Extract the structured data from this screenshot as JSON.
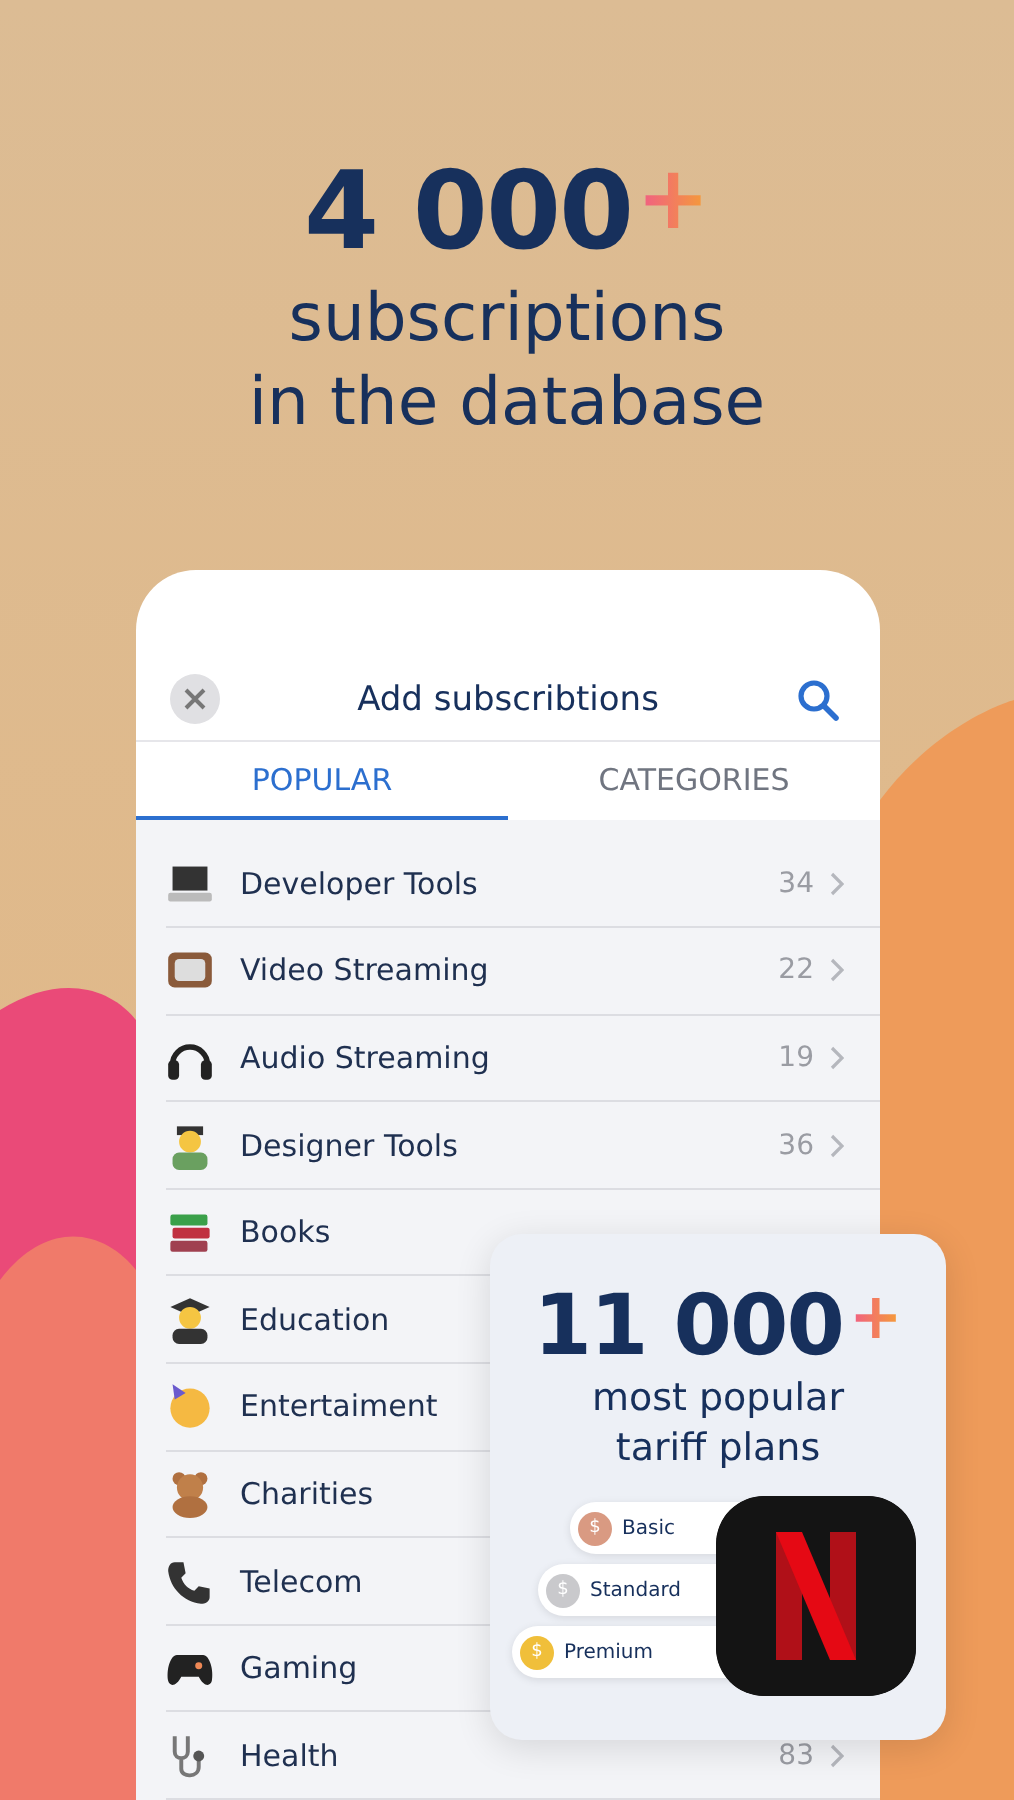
{
  "headline": {
    "number": "4 000",
    "plus": "+",
    "lines": [
      "subscriptions",
      "in the database"
    ]
  },
  "panel": {
    "title": "Add subscribtions",
    "tabs": [
      {
        "label": "POPULAR",
        "selected": true
      },
      {
        "label": "CATEGORIES",
        "selected": false
      }
    ],
    "rows": [
      {
        "label": "Developer Tools",
        "count": "34"
      },
      {
        "label": "Video Streaming",
        "count": "22"
      },
      {
        "label": "Audio Streaming",
        "count": "19"
      },
      {
        "label": "Designer Tools",
        "count": "36"
      },
      {
        "label": "Books"
      },
      {
        "label": "Education"
      },
      {
        "label": "Entertaiment"
      },
      {
        "label": "Charities"
      },
      {
        "label": "Telecom"
      },
      {
        "label": "Gaming"
      },
      {
        "label": "Health",
        "count": "83"
      }
    ]
  },
  "plans_card": {
    "number": "11 000",
    "plus": "+",
    "lines": [
      "most popular",
      "tariff plans"
    ],
    "plans": [
      {
        "coin": "$",
        "label": "Basic",
        "color": "#d99a82"
      },
      {
        "coin": "$",
        "label": "Standard",
        "color": "#c9c9cc"
      },
      {
        "coin": "$",
        "label": "Premium",
        "color": "#f0bf3a"
      }
    ]
  }
}
